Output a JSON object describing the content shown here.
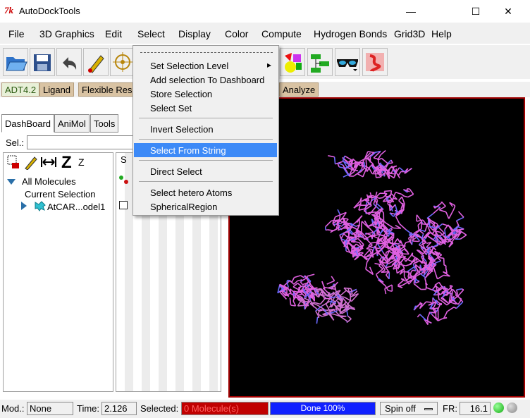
{
  "window": {
    "title": "AutoDockTools",
    "min_label": "—",
    "max_label": "☐",
    "close_label": "✕"
  },
  "menubar": {
    "items": [
      "File",
      "3D Graphics",
      "Edit",
      "Select",
      "Display",
      "Color",
      "Compute",
      "Hydrogen Bonds",
      "Grid3D",
      "Help"
    ]
  },
  "toolbar": {
    "icons": [
      "open-folder-icon",
      "save-icon",
      "undo-icon",
      "select-pencil-icon",
      "target-icon",
      "molecule-shapes-icon",
      "network-icon",
      "glasses-icon",
      "ribbon-icon"
    ]
  },
  "plugin_tabs": [
    "ADT4.2",
    "Ligand",
    "Flexible Res",
    "Analyze"
  ],
  "dashboard": {
    "tabs": [
      "DashBoard",
      "AniMol",
      "Tools"
    ],
    "sel_label": "Sel.:",
    "sel_value": "",
    "tree": {
      "all_molecules": "All Molecules",
      "current_selection": "Current Selection",
      "molecule": "AtCAR...odel1"
    },
    "col_s": "S",
    "z_large": "Z",
    "z_small": "Z"
  },
  "select_menu": {
    "items": [
      {
        "label": "Set Selection Level",
        "submenu": true
      },
      {
        "label": "Add selection To Dashboard"
      },
      {
        "label": "Store Selection"
      },
      {
        "label": "Select Set"
      },
      {
        "label": "Invert Selection"
      },
      {
        "label": "Select From String",
        "highlighted": true
      },
      {
        "label": "Direct Select"
      },
      {
        "label": "Select hetero Atoms"
      },
      {
        "label": "SphericalRegion"
      }
    ],
    "submenu_arrow": "▸"
  },
  "statusbar": {
    "mod_label": "Mod.:",
    "mod_value": "None",
    "time_label": "Time:",
    "time_value": "2.126",
    "selected_label": "Selected:",
    "selected_value": "0 Molecule(s)",
    "progress_text": "Done 100%",
    "progress": 1.0,
    "spin_label": "Spin off",
    "fr_label": "FR:",
    "fr_value": "16.1"
  },
  "colors": {
    "accent_highlight": "#3d8af7",
    "viewer_bg": "#000000",
    "viewer_border": "#a00000",
    "molecule": "#e060e0",
    "selected_bg": "#c00000",
    "progress_fill": "#1020ff",
    "status_led": "#22aa22"
  }
}
